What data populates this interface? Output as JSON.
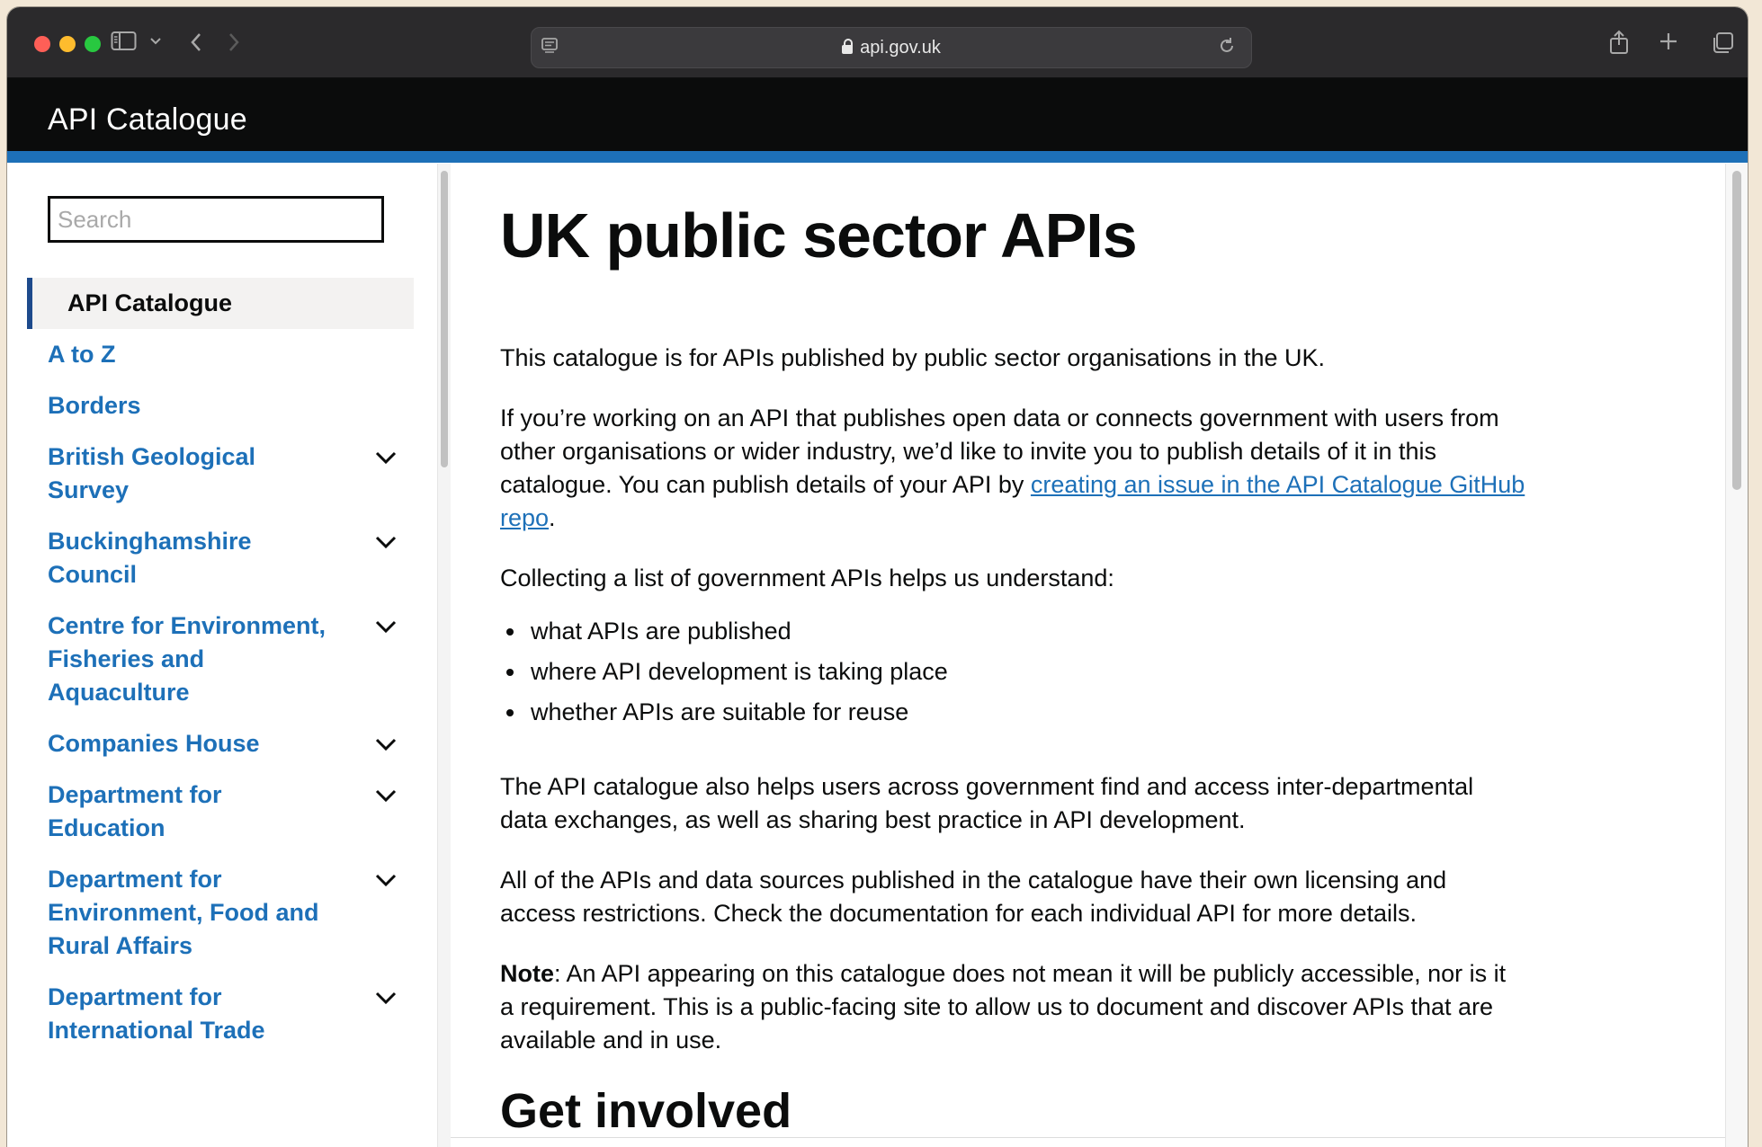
{
  "browser": {
    "url": "api.gov.uk"
  },
  "site": {
    "title": "API Catalogue"
  },
  "sidebar": {
    "search_placeholder": "Search",
    "items": [
      {
        "label": "API Catalogue",
        "active": true,
        "expandable": false
      },
      {
        "label": "A to Z",
        "active": false,
        "expandable": false
      },
      {
        "label": "Borders",
        "active": false,
        "expandable": false
      },
      {
        "label": "British Geological Survey",
        "active": false,
        "expandable": true
      },
      {
        "label": "Buckinghamshire Council",
        "active": false,
        "expandable": true
      },
      {
        "label": "Centre for Environment, Fisheries and Aquaculture",
        "active": false,
        "expandable": true
      },
      {
        "label": "Companies House",
        "active": false,
        "expandable": true
      },
      {
        "label": "Department for Education",
        "active": false,
        "expandable": true
      },
      {
        "label": "Department for Environment, Food and Rural Affairs",
        "active": false,
        "expandable": true
      },
      {
        "label": "Department for International Trade",
        "active": false,
        "expandable": true
      }
    ]
  },
  "main": {
    "heading": "UK public sector APIs",
    "intro": "This catalogue is for APIs published by public sector organisations in the UK.",
    "invite_text": "If you’re working on an API that publishes open data or connects government with users from other organisations or wider industry, we’d like to invite you to publish details of it in this catalogue. You can publish details of your API by ",
    "invite_link": "creating an issue in the API Catalogue GitHub repo",
    "invite_end": ".",
    "collecting": "Collecting a list of government APIs helps us understand:",
    "bullets": [
      "what APIs are published",
      "where API development is taking place",
      "whether APIs are suitable for reuse"
    ],
    "also_helps": "The API catalogue also helps users across government find and access inter-departmental data exchanges, as well as sharing best practice in API development.",
    "licensing": "All of the APIs and data sources published in the catalogue have their own licensing and access restrictions. Check the documentation for each individual API for more details.",
    "note_label": "Note",
    "note_text": ": An API appearing on this catalogue does not mean it will be publicly accessible, nor is it a requirement. This is a public-facing site to allow us to document and discover APIs that are available and in use.",
    "next_heading": "Get involved"
  },
  "colors": {
    "link": "#1d70b8",
    "header_bg": "#0b0c0c",
    "header_stripe": "#1d70b8"
  }
}
